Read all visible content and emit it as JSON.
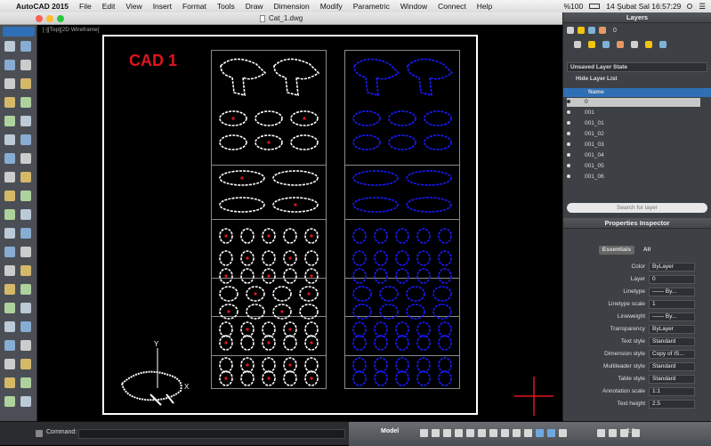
{
  "menubar": {
    "app": "AutoCAD 2015",
    "items": [
      "File",
      "Edit",
      "View",
      "Insert",
      "Format",
      "Tools",
      "Draw",
      "Dimension",
      "Modify",
      "Parametric",
      "Window",
      "Connect",
      "Help"
    ],
    "battery": "%100",
    "datetime": "14 Şubat Sal  16:57:29"
  },
  "window": {
    "title": "Cat_1.dwg"
  },
  "viewport": {
    "label": "[-][Top][2D Wireframe]",
    "drawing_title": "CAD 1"
  },
  "colors": {
    "title_red": "#e1141e",
    "blue": "#1a1aff",
    "white": "#ffffff",
    "panel": "#3d4146"
  },
  "layers_panel": {
    "title": "Layers",
    "current_layer": "0",
    "layer_state": "Unsaved Layer State",
    "hide_list": "Hide Layer List",
    "name_header": "Name",
    "layers": [
      "0",
      "001",
      "001_01",
      "001_02",
      "001_03",
      "001_04",
      "001_05",
      "001_06"
    ],
    "search_placeholder": "Search for layer"
  },
  "properties": {
    "title": "Properties Inspector",
    "tabs": [
      "Essentials",
      "All"
    ],
    "rows": [
      {
        "label": "Color",
        "value": "ByLayer"
      },
      {
        "label": "Layer",
        "value": "0"
      },
      {
        "label": "Linetype",
        "value": "—— By..."
      },
      {
        "label": "Linetype scale",
        "value": "1"
      },
      {
        "label": "Lineweight",
        "value": "—— By..."
      },
      {
        "label": "Transparency",
        "value": "ByLayer"
      },
      {
        "label": "Text style",
        "value": "Standard"
      },
      {
        "label": "Dimension style",
        "value": "Copy of IS..."
      },
      {
        "label": "Multileader style",
        "value": "Standard"
      },
      {
        "label": "Table style",
        "value": "Standard"
      },
      {
        "label": "Annotation scale",
        "value": "1:1"
      },
      {
        "label": "Text height",
        "value": "2.5"
      }
    ]
  },
  "command": {
    "label": "Command:"
  },
  "statusbar": {
    "model": "Model",
    "scale": "1:1"
  }
}
